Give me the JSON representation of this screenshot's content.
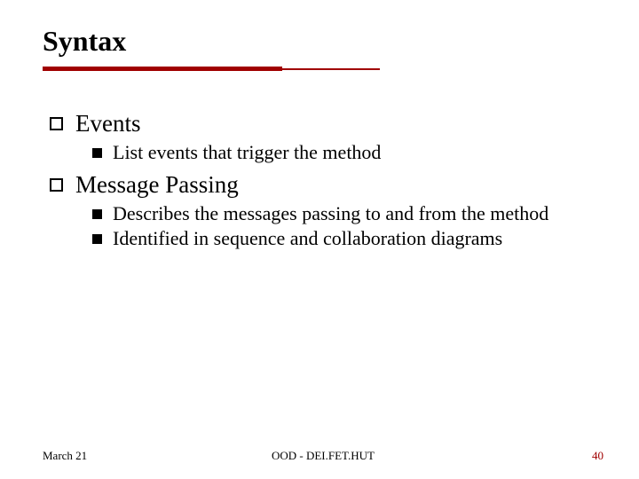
{
  "title": "Syntax",
  "sections": [
    {
      "heading": "Events",
      "items": [
        "List events that trigger the method"
      ]
    },
    {
      "heading": "Message Passing",
      "items": [
        "Describes the messages passing to and from the method",
        "Identified in sequence and collaboration diagrams"
      ]
    }
  ],
  "footer": {
    "left": "March 21",
    "center": "OOD - DEI.FET.HUT",
    "right": "40"
  }
}
